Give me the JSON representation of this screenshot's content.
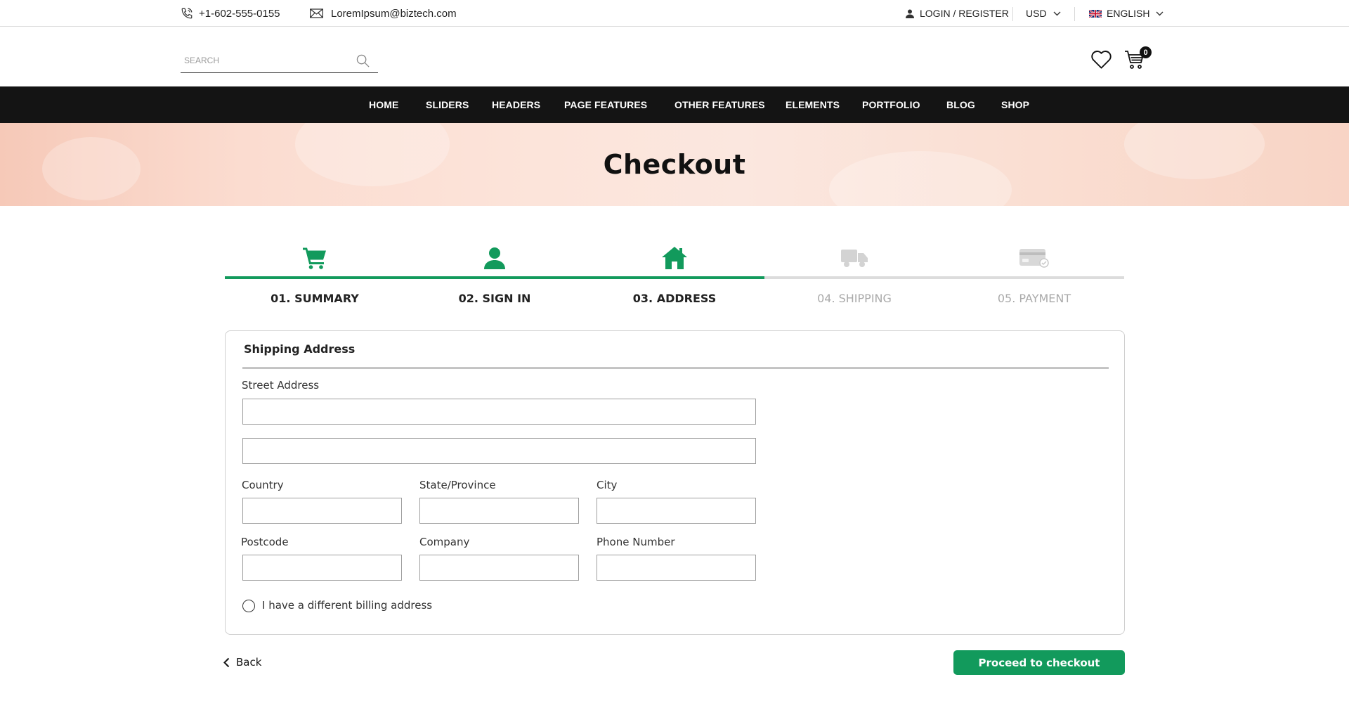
{
  "topbar": {
    "phone": "+1-602-555-0155",
    "email": "LoremIpsum@biztech.com",
    "login": "LOGIN / REGISTER",
    "currency": "USD",
    "language": "ENGLISH"
  },
  "header": {
    "search_placeholder": "SEARCH",
    "cart_count": "0",
    "icons": [
      "search-icon",
      "heart-icon",
      "cart-icon"
    ]
  },
  "nav": {
    "items": [
      {
        "label": "HOME"
      },
      {
        "label": "SLIDERS"
      },
      {
        "label": "HEADERS"
      },
      {
        "label": "PAGE FEATURES"
      },
      {
        "label": "OTHER FEATURES"
      },
      {
        "label": "ELEMENTS"
      },
      {
        "label": "PORTFOLIO"
      },
      {
        "label": "BLOG"
      },
      {
        "label": "SHOP"
      }
    ]
  },
  "hero": {
    "title": "Checkout"
  },
  "steps": [
    {
      "label": "01. SUMMARY",
      "icon": "cart-icon",
      "completed": true
    },
    {
      "label": "02. SIGN IN",
      "icon": "user-icon",
      "completed": true
    },
    {
      "label": "03. ADDRESS",
      "icon": "home-icon",
      "completed": true
    },
    {
      "label": "04. SHIPPING",
      "icon": "truck-icon",
      "completed": false
    },
    {
      "label": "05. PAYMENT",
      "icon": "credit-card-icon",
      "completed": false
    }
  ],
  "form": {
    "title": "Shipping Address",
    "street_label": "Street Address",
    "country_label": "Country",
    "state_label": "State/Province",
    "city_label": "City",
    "postcode_label": "Postcode",
    "company_label": "Company",
    "phone_label": "Phone Number",
    "billing_checkbox_label": "I have a different billing address"
  },
  "actions": {
    "back": "Back",
    "proceed": "Proceed to checkout"
  },
  "colors": {
    "accent": "#129a5c",
    "nav_bg": "#141414",
    "inactive_step": "#aaaaaa",
    "hero_tint": "#fbdcd0"
  }
}
